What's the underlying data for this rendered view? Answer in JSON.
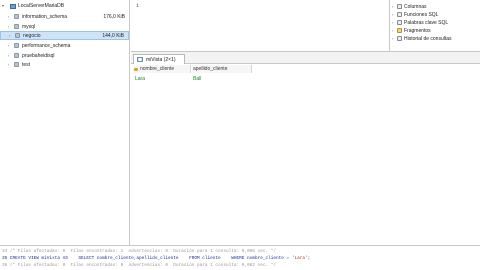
{
  "tree": {
    "server": "LocalServerMariaDB",
    "databases": [
      {
        "name": "information_schema",
        "size": "176,0 KiB",
        "selected": false
      },
      {
        "name": "mysql",
        "size": "",
        "selected": false
      },
      {
        "name": "negocio",
        "size": "144,0 KiB",
        "selected": true
      },
      {
        "name": "performance_schema",
        "size": "",
        "selected": false
      },
      {
        "name": "pruebaheidisql",
        "size": "",
        "selected": false
      },
      {
        "name": "test",
        "size": "",
        "selected": false
      }
    ]
  },
  "editor": {
    "line_number": "1"
  },
  "helper": {
    "items": [
      {
        "label": "Columnas",
        "icon": "columns-icon"
      },
      {
        "label": "Funciones SQL",
        "icon": "functions-icon"
      },
      {
        "label": "Palabras clave SQL",
        "icon": "keywords-icon"
      },
      {
        "label": "Fragmentos",
        "icon": "snippets-icon"
      },
      {
        "label": "Historial de consultas",
        "icon": "history-icon"
      }
    ]
  },
  "result": {
    "tab_label": "miVista (2×1)",
    "columns": [
      "nombre_cliente",
      "apellido_cliente"
    ],
    "rows": [
      [
        "Lara",
        "Ball"
      ]
    ]
  },
  "log": {
    "line1": "34 /* Filas afectadas: 0  Filas encontradas: 1  Advertencias: 0  Duración para 1 consulta: 0,000 sec. */",
    "line2_cmd": "35 CREATE VIEW miVista AS    SELECT nombre_cliente,apellido_cliente    FROM cliente    WHERE nombre_cliente = ",
    "line2_str": "'Lara'",
    "line2_end": ";",
    "line3": "36 /* Filas afectadas: 0  Filas encontradas: 0  Advertencias: 0  Duración para 1 consulta: 0,062 sec. */"
  }
}
